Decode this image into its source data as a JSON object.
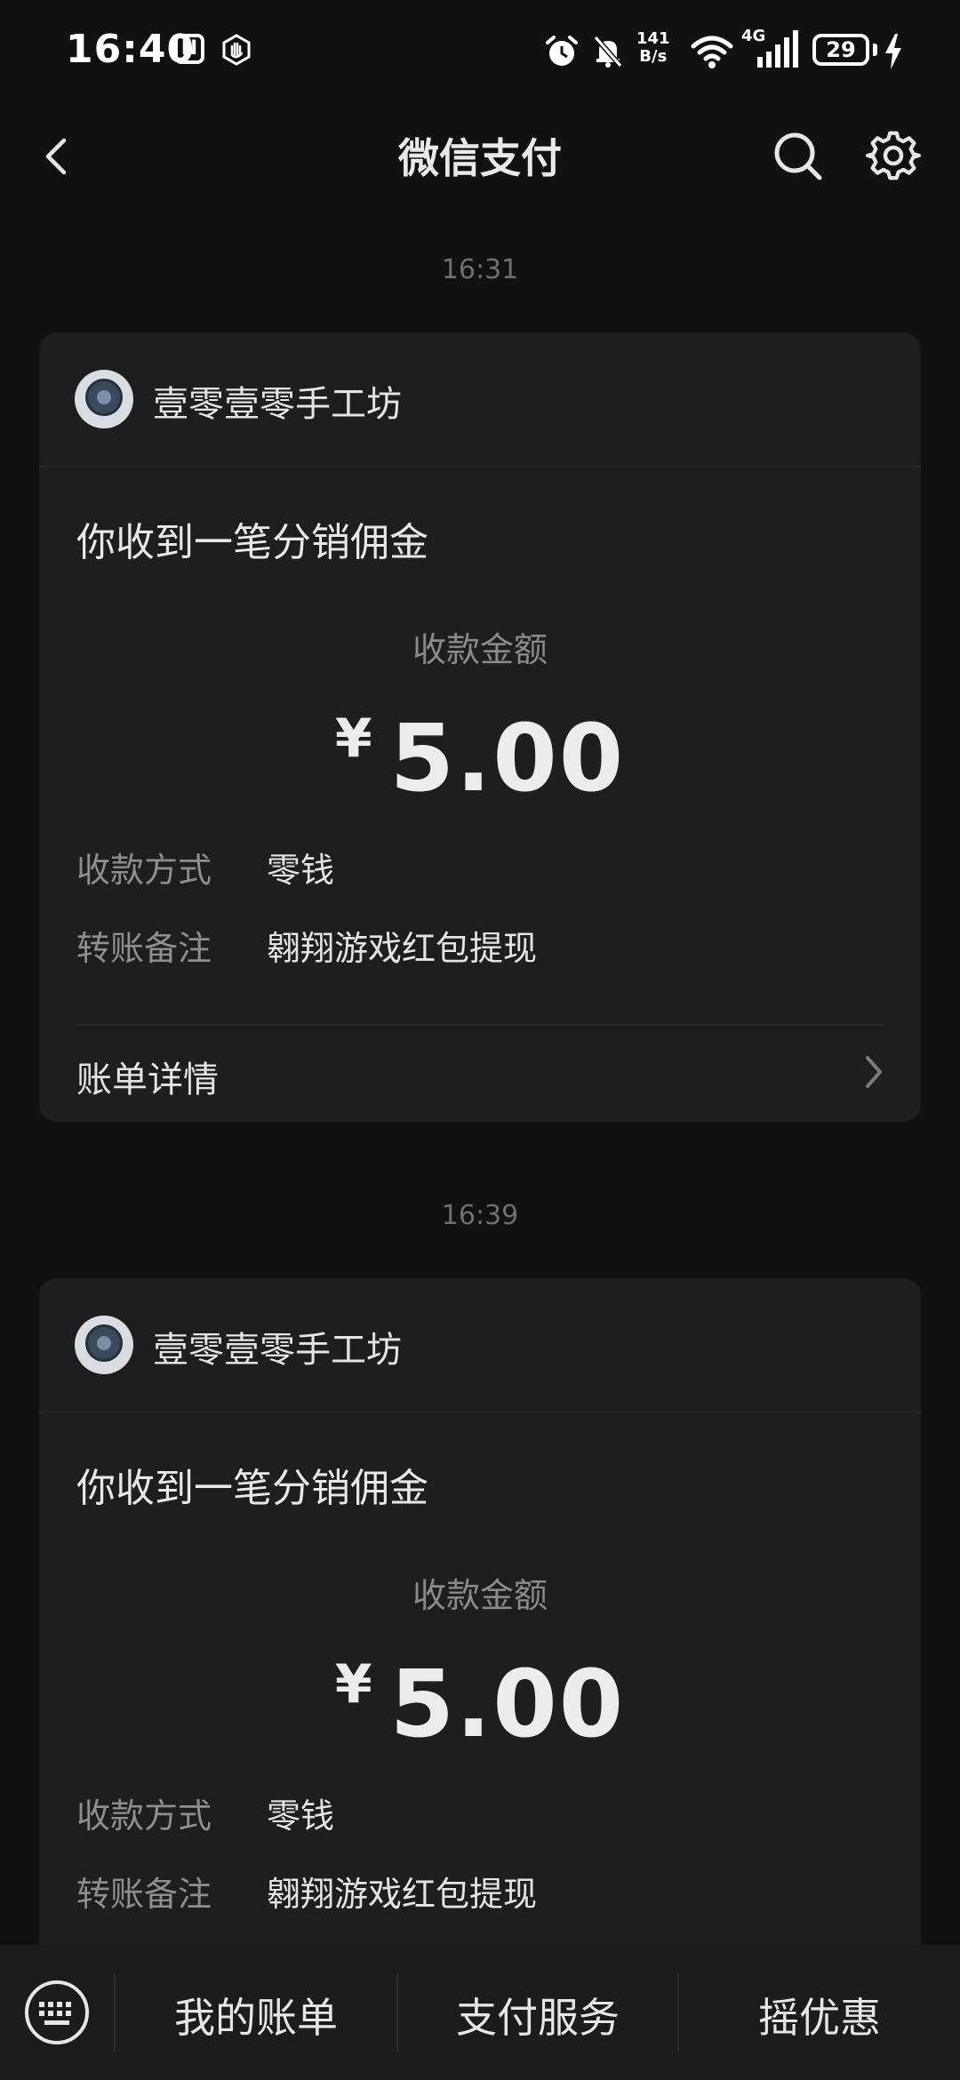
{
  "status_bar": {
    "time": "16:40",
    "nfc_label": "N",
    "net_speed_value": "141",
    "net_speed_unit": "B/s",
    "network_type": "4G",
    "battery": "29",
    "icons": [
      "nfc-icon",
      "hand-gesture-icon",
      "alarm-icon",
      "mute-bell-icon",
      "wifi-icon",
      "signal-icon",
      "battery-icon",
      "charging-icon"
    ]
  },
  "header": {
    "title": "微信支付",
    "icons": [
      "back-arrow-icon",
      "search-icon",
      "gear-icon"
    ]
  },
  "messages": [
    {
      "time": "16:31",
      "shop_name": "壹零壹零手工坊",
      "title": "你收到一笔分销佣金",
      "amount_label": "收款金额",
      "currency": "¥",
      "amount": "5.00",
      "method_label": "收款方式",
      "method_value": "零钱",
      "note_label": "转账备注",
      "note_value": "翱翔游戏红包提现",
      "detail_label": "账单详情"
    },
    {
      "time": "16:39",
      "shop_name": "壹零壹零手工坊",
      "title": "你收到一笔分销佣金",
      "amount_label": "收款金额",
      "currency": "¥",
      "amount": "5.00",
      "method_label": "收款方式",
      "method_value": "零钱",
      "note_label": "转账备注",
      "note_value": "翱翔游戏红包提现"
    }
  ],
  "bottom_bar": {
    "items": [
      "我的账单",
      "支付服务",
      "摇优惠"
    ],
    "icons": [
      "keyboard-icon"
    ]
  },
  "colors": {
    "background": "#111111",
    "card": "#1e1e1e",
    "bottom_bar": "#1c1c1c",
    "text_primary": "#e6e6e6",
    "text_secondary": "#8e8e8e"
  }
}
